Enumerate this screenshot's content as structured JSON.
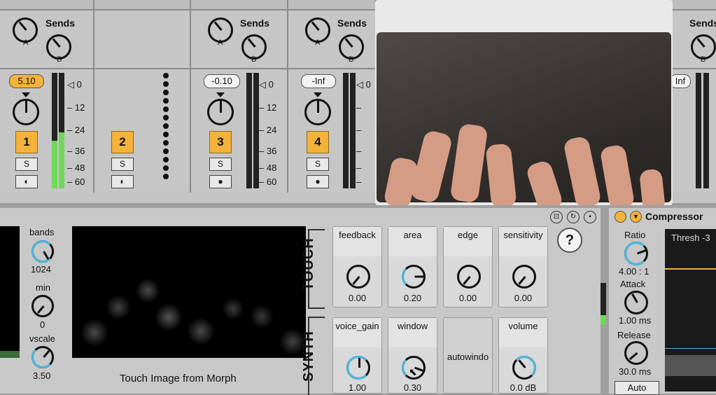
{
  "mixer": {
    "strips": [
      {
        "sends_label": "Sends",
        "knob_a": "A",
        "knob_b": "B",
        "volume": "5.10",
        "track": "1",
        "solo": "S"
      },
      {
        "track": "2",
        "solo": "S"
      },
      {
        "sends_label": "Sends",
        "knob_a": "A",
        "knob_b": "B",
        "volume": "-0.10",
        "track": "3",
        "solo": "S"
      },
      {
        "sends_label": "Sends",
        "knob_a": "A",
        "knob_b": "B",
        "volume": "-Inf",
        "track": "4",
        "solo": "S"
      },
      {
        "sends_label": "Sends",
        "knob_b": "B",
        "volume": "Inf"
      }
    ],
    "scale": [
      "0",
      "12",
      "24",
      "36",
      "48",
      "60"
    ],
    "scale_partial": "0"
  },
  "device": {
    "left_params": [
      {
        "label": "bands",
        "value": "1024"
      },
      {
        "label": "min",
        "value": "0"
      },
      {
        "label": "vscale",
        "value": "3.50"
      }
    ],
    "display_caption": "Touch Image from Morph",
    "section_touch": "TOUCH",
    "section_synth": "SYNTH",
    "help": "?",
    "touch_params": [
      {
        "label": "feedback",
        "value": "0.00"
      },
      {
        "label": "area",
        "value": "0.20"
      },
      {
        "label": "edge",
        "value": "0.00"
      },
      {
        "label": "sensitivity",
        "value": "0.00"
      }
    ],
    "synth_params": [
      {
        "label": "voice_gain",
        "value": "1.00"
      },
      {
        "label": "window",
        "value": "0.30"
      },
      {
        "label": "autowindo",
        "value": ""
      },
      {
        "label": "volume",
        "value": "0.0 dB"
      }
    ]
  },
  "compressor": {
    "title": "Compressor",
    "ratio_label": "Ratio",
    "ratio_value": "4.00 : 1",
    "attack_label": "Attack",
    "attack_value": "1.00 ms",
    "release_label": "Release",
    "release_value": "30.0 ms",
    "auto": "Auto",
    "thresh": "Thresh -3"
  },
  "colors": {
    "accent": "#f3b23a",
    "knob_arc": "#4ab8e0",
    "meter": "#6fd85a"
  }
}
